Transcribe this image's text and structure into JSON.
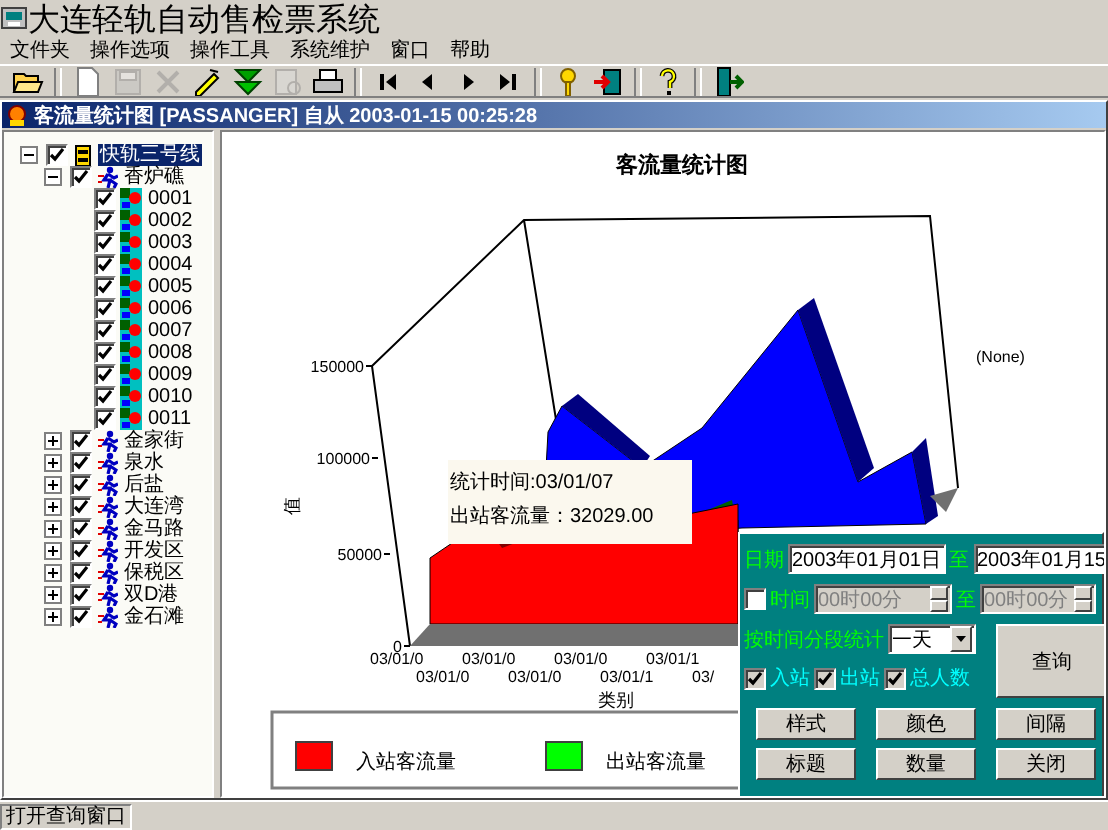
{
  "window": {
    "title": "大连轻轨自动售检票系统"
  },
  "menu": [
    "文件夹",
    "操作选项",
    "操作工具",
    "系统维护",
    "窗口",
    "帮助"
  ],
  "toolbar": [
    {
      "kind": "open",
      "disabled": false
    },
    {
      "kind": "separator"
    },
    {
      "kind": "new",
      "disabled": false
    },
    {
      "kind": "save",
      "disabled": true
    },
    {
      "kind": "delete",
      "disabled": true
    },
    {
      "kind": "edit",
      "disabled": false
    },
    {
      "kind": "download",
      "disabled": false
    },
    {
      "kind": "preview",
      "disabled": true
    },
    {
      "kind": "print",
      "disabled": false
    },
    {
      "kind": "separator"
    },
    {
      "kind": "first",
      "disabled": false
    },
    {
      "kind": "prev",
      "disabled": false
    },
    {
      "kind": "next",
      "disabled": false
    },
    {
      "kind": "last",
      "disabled": false
    },
    {
      "kind": "separator"
    },
    {
      "kind": "key",
      "disabled": false
    },
    {
      "kind": "exit",
      "disabled": false
    },
    {
      "kind": "separator"
    },
    {
      "kind": "help",
      "disabled": false
    },
    {
      "kind": "separator"
    },
    {
      "kind": "logout",
      "disabled": false
    }
  ],
  "document": {
    "title": "客流量统计图 [PASSANGER] 自从 2003-01-15 00:25:28"
  },
  "tree": [
    {
      "label": "快轨三号线",
      "kind": "line",
      "checked": true,
      "expanded": true,
      "selected": true,
      "children": [
        {
          "label": "香炉礁",
          "kind": "station",
          "checked": true,
          "expanded": true,
          "selected": false,
          "children": [
            {
              "label": "0001",
              "kind": "device",
              "checked": true,
              "selected": false
            },
            {
              "label": "0002",
              "kind": "device",
              "checked": true,
              "selected": false
            },
            {
              "label": "0003",
              "kind": "device",
              "checked": true,
              "selected": false
            },
            {
              "label": "0004",
              "kind": "device",
              "checked": true,
              "selected": false
            },
            {
              "label": "0005",
              "kind": "device",
              "checked": true,
              "selected": false
            },
            {
              "label": "0006",
              "kind": "device",
              "checked": true,
              "selected": false
            },
            {
              "label": "0007",
              "kind": "device",
              "checked": true,
              "selected": false
            },
            {
              "label": "0008",
              "kind": "device",
              "checked": true,
              "selected": false
            },
            {
              "label": "0009",
              "kind": "device",
              "checked": true,
              "selected": false
            },
            {
              "label": "0010",
              "kind": "device",
              "checked": true,
              "selected": false
            },
            {
              "label": "0011",
              "kind": "device",
              "checked": true,
              "selected": false
            }
          ]
        },
        {
          "label": "金家街",
          "kind": "station",
          "checked": true,
          "expanded": false,
          "selected": false
        },
        {
          "label": "泉水",
          "kind": "station",
          "checked": true,
          "expanded": false,
          "selected": false
        },
        {
          "label": "后盐",
          "kind": "station",
          "checked": true,
          "expanded": false,
          "selected": false
        },
        {
          "label": "大连湾",
          "kind": "station",
          "checked": true,
          "expanded": false,
          "selected": false
        },
        {
          "label": "金马路",
          "kind": "station",
          "checked": true,
          "expanded": false,
          "selected": false
        },
        {
          "label": "开发区",
          "kind": "station",
          "checked": true,
          "expanded": false,
          "selected": false
        },
        {
          "label": "保税区",
          "kind": "station",
          "checked": true,
          "expanded": false,
          "selected": false
        },
        {
          "label": "双D港",
          "kind": "station",
          "checked": true,
          "expanded": false,
          "selected": false
        },
        {
          "label": "金石滩",
          "kind": "station",
          "checked": true,
          "expanded": false,
          "selected": false
        }
      ]
    }
  ],
  "chart": {
    "title": "客流量统计图",
    "ylabel": "值",
    "yticks": [
      "150000",
      "100000",
      "50000",
      "0"
    ],
    "xticks": [
      "03/01/0",
      "03/01/0",
      "03/01/0",
      "03/01/0",
      "03/01/0",
      "03/01/1",
      "03/01/1",
      "03/"
    ],
    "xlabel": "类别",
    "series_label": "(None)",
    "tooltip": [
      "统计时间:03/01/07",
      "出站客流量：32029.00"
    ],
    "legend": [
      {
        "label": "入站客流量",
        "color": "#ff0000"
      },
      {
        "label": "出站客流量",
        "color": "#00ff00"
      }
    ]
  },
  "query": {
    "date_label": "日期",
    "date_from": "2003年01月01日",
    "date_to_label": "至",
    "date_to": "2003年01月15",
    "time": {
      "checked": false,
      "label": "时间",
      "from": "00时00分",
      "to_label": "至",
      "to": "00时00分"
    },
    "interval_label": "按时间分段统计",
    "interval": "一天",
    "query_button": "查询",
    "series": [
      {
        "label": "入站",
        "checked": true
      },
      {
        "label": "出站",
        "checked": true
      },
      {
        "label": "总人数",
        "checked": true
      }
    ],
    "buttons": [
      "样式",
      "颜色",
      "间隔",
      "标题",
      "数量",
      "关闭"
    ]
  },
  "status_bar": "打开查询窗口"
}
